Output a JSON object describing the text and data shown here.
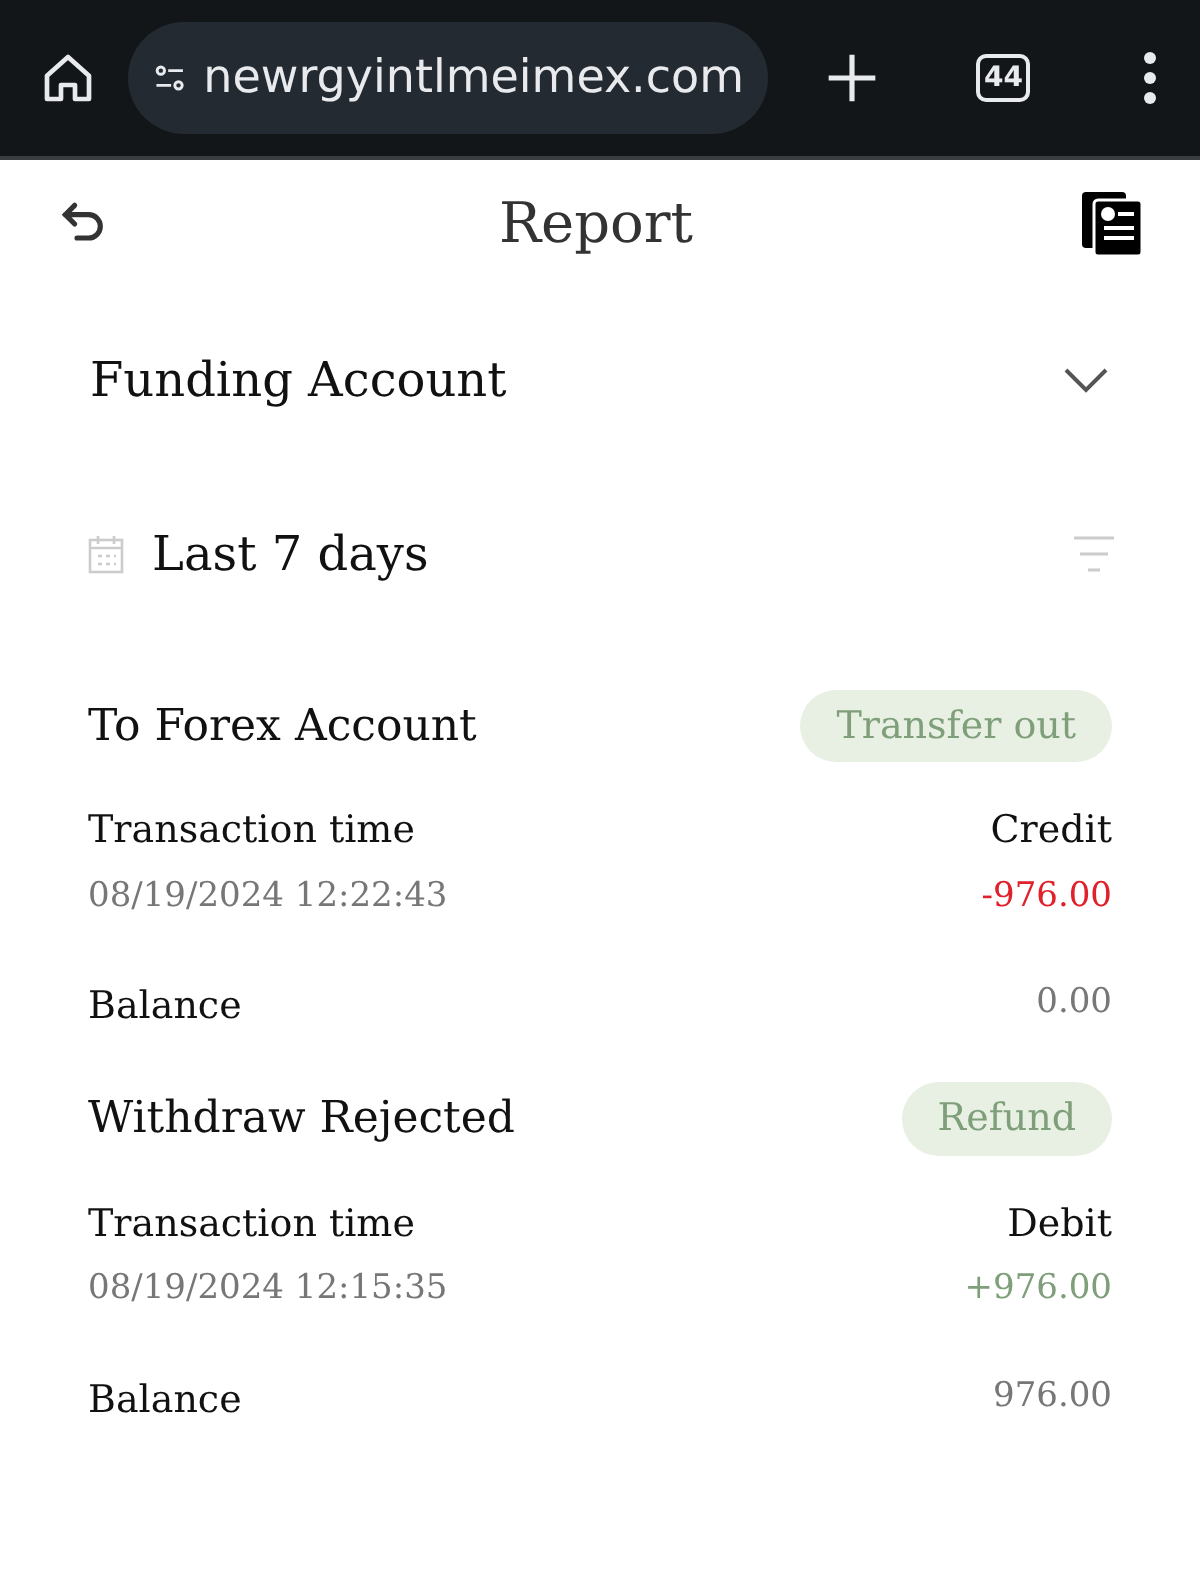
{
  "browser": {
    "url": "newrgyintlmeimex.com",
    "tab_count": "44"
  },
  "header": {
    "title": "Report"
  },
  "account": {
    "label": "Funding Account"
  },
  "period": {
    "label": "Last 7 days"
  },
  "transactions": [
    {
      "title": "To Forex Account",
      "tag": "Transfer out",
      "time_label": "Transaction time",
      "time": "08/19/2024 12:22:43",
      "kind": "credit",
      "type_label": "Credit",
      "amount": "-976.00",
      "balance_label": "Balance",
      "balance": "0.00"
    },
    {
      "title": "Withdraw Rejected",
      "tag": "Refund",
      "time_label": "Transaction time",
      "time": "08/19/2024 12:15:35",
      "kind": "debit",
      "type_label": "Debit",
      "amount": "+976.00",
      "balance_label": "Balance",
      "balance": "976.00"
    }
  ]
}
